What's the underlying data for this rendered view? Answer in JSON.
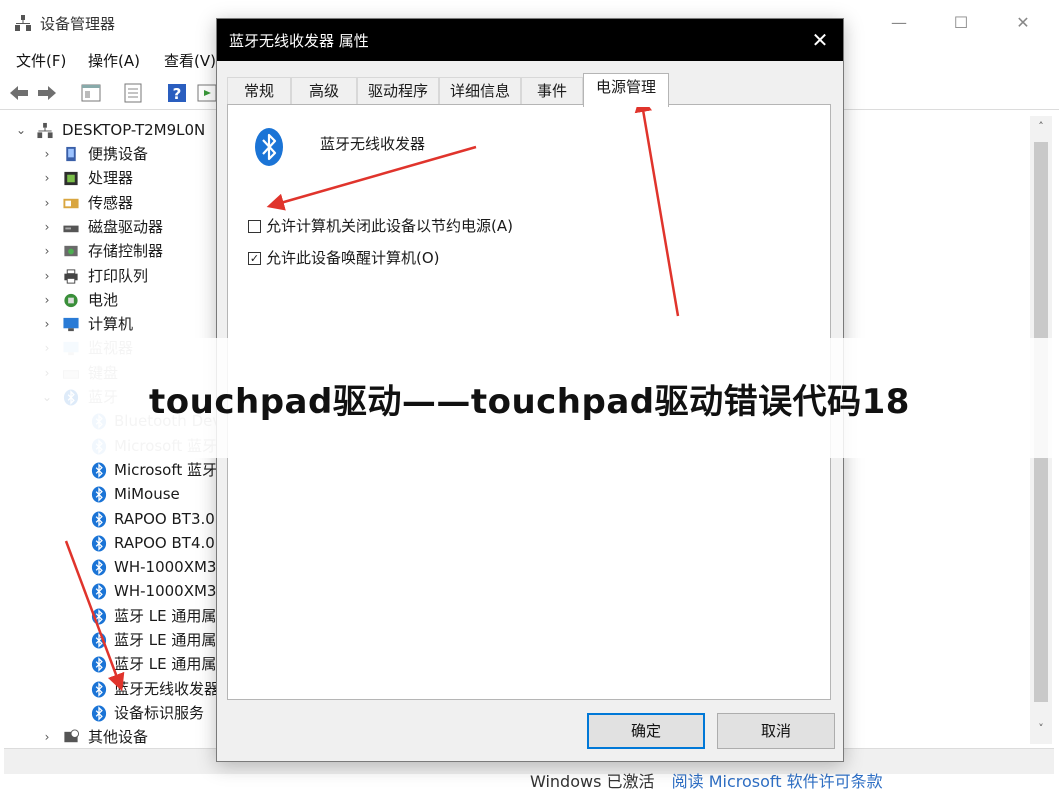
{
  "device_manager": {
    "title": "设备管理器",
    "controls": {
      "minimize": "—",
      "maximize": "☐",
      "close": "✕"
    },
    "menu": {
      "file": "文件(F)",
      "action": "操作(A)",
      "view": "查看(V)"
    },
    "tree": {
      "root": "DESKTOP-T2M9L0N",
      "items": [
        {
          "label": "便携设备",
          "chevron": "›",
          "icon": "portable-device-icon",
          "dim": false
        },
        {
          "label": "处理器",
          "chevron": "›",
          "icon": "processor-icon",
          "dim": false
        },
        {
          "label": "传感器",
          "chevron": "›",
          "icon": "sensor-icon",
          "dim": false
        },
        {
          "label": "磁盘驱动器",
          "chevron": "›",
          "icon": "disk-drive-icon",
          "dim": false
        },
        {
          "label": "存储控制器",
          "chevron": "›",
          "icon": "storage-controller-icon",
          "dim": false
        },
        {
          "label": "打印队列",
          "chevron": "›",
          "icon": "printer-icon",
          "dim": false
        },
        {
          "label": "电池",
          "chevron": "›",
          "icon": "battery-icon",
          "dim": false
        },
        {
          "label": "计算机",
          "chevron": "›",
          "icon": "computer-icon",
          "dim": false
        },
        {
          "label": "监视器",
          "chevron": "›",
          "icon": "monitor-icon",
          "dim": true
        },
        {
          "label": "键盘",
          "chevron": "›",
          "icon": "keyboard-icon",
          "dim": true
        },
        {
          "label": "蓝牙",
          "chevron": "⌄",
          "icon": "bluetooth-icon",
          "dim": true
        }
      ],
      "bluetooth_children": [
        {
          "label": "Bluetooth Dev",
          "dim": true
        },
        {
          "label": "Microsoft 蓝牙",
          "dim": true
        },
        {
          "label": "Microsoft 蓝牙",
          "dim": false
        },
        {
          "label": "MiMouse",
          "dim": false
        },
        {
          "label": "RAPOO BT3.0",
          "dim": false
        },
        {
          "label": "RAPOO BT4.0",
          "dim": false
        },
        {
          "label": "WH-1000XM3",
          "dim": false
        },
        {
          "label": "WH-1000XM3",
          "dim": false
        },
        {
          "label": "蓝牙 LE 通用属",
          "dim": false
        },
        {
          "label": "蓝牙 LE 通用属",
          "dim": false
        },
        {
          "label": "蓝牙 LE 通用属",
          "dim": false
        },
        {
          "label": "蓝牙无线收发器",
          "dim": false
        },
        {
          "label": "设备标识服务",
          "dim": false
        }
      ],
      "last_item": {
        "label": "其他设备",
        "chevron": "›"
      }
    },
    "scroll": {
      "up": "˄",
      "down": "˅"
    }
  },
  "activation": {
    "status": "Windows 已激活",
    "link": "阅读 Microsoft 软件许可条款"
  },
  "dialog": {
    "title": "蓝牙无线收发器 属性",
    "close": "✕",
    "tabs": [
      {
        "label": "常规",
        "active": false
      },
      {
        "label": "高级",
        "active": false
      },
      {
        "label": "驱动程序",
        "active": false
      },
      {
        "label": "详细信息",
        "active": false
      },
      {
        "label": "事件",
        "active": false
      },
      {
        "label": "电源管理",
        "active": true
      }
    ],
    "device_name": "蓝牙无线收发器",
    "options": {
      "allow_off": {
        "label": "允许计算机关闭此设备以节约电源(A)",
        "checked": false
      },
      "allow_wake": {
        "label": "允许此设备唤醒计算机(O)",
        "checked": true
      }
    },
    "buttons": {
      "ok": "确定",
      "cancel": "取消"
    }
  },
  "banner": {
    "text": "touchpad驱动——touchpad驱动错误代码18"
  },
  "colors": {
    "bluetooth_blue": "#1b74d6",
    "arrow_red": "#e0342c",
    "ok_border": "#0078d7"
  }
}
